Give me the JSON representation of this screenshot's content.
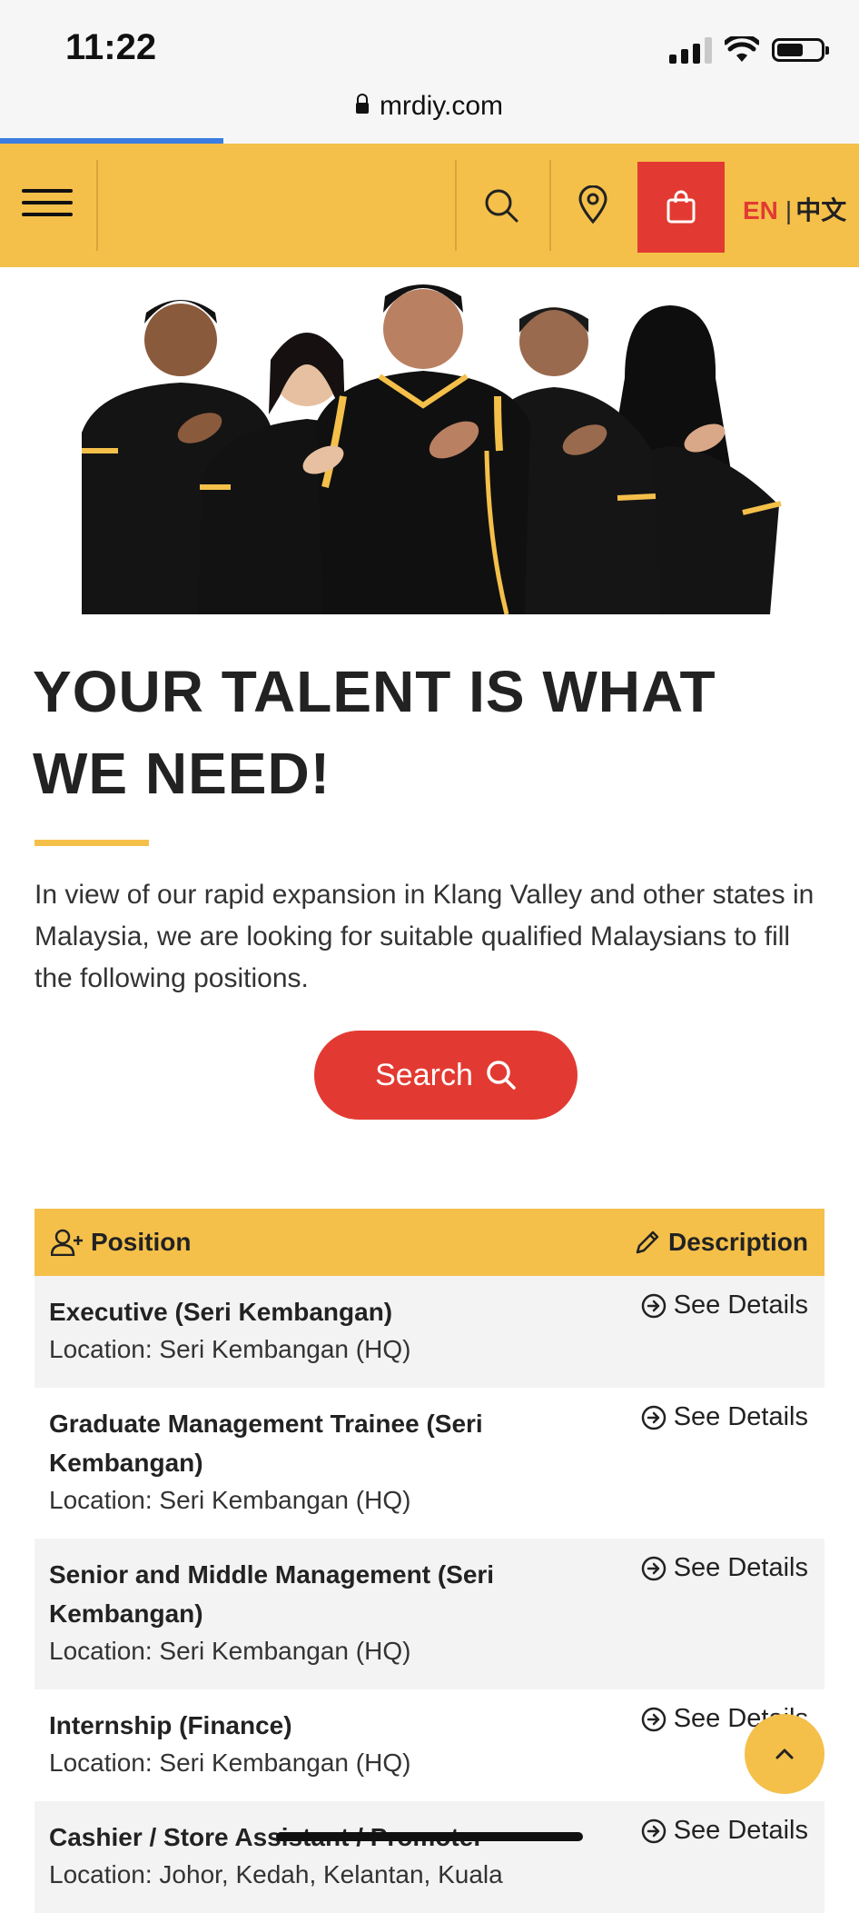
{
  "status": {
    "time": "11:22",
    "url": "mrdiy.com",
    "page_load_progress_fraction": 0.26
  },
  "nav": {
    "lang_en": "EN",
    "lang_separator": "|",
    "lang_zh": "中文"
  },
  "hero": {
    "heading": "YOUR TALENT IS WHAT WE NEED!",
    "intro": "In view of our rapid expansion in Klang Valley and other states in Malaysia, we are looking for suitable qualified Malaysians to fill the following positions.",
    "search_label": "Search"
  },
  "table": {
    "col_position": "Position",
    "col_description": "Description",
    "rows": [
      {
        "title": "Executive (Seri Kembangan)",
        "location": "Location: Seri Kembangan (HQ)",
        "link": "See Details"
      },
      {
        "title": "Graduate Management Trainee (Seri Kembangan)",
        "location": "Location: Seri Kembangan (HQ)",
        "link": "See Details"
      },
      {
        "title": "Senior and Middle Management (Seri Kembangan)",
        "location": "Location: Seri Kembangan (HQ)",
        "link": "See Details"
      },
      {
        "title": "Internship (Finance)",
        "location": "Location: Seri Kembangan (HQ)",
        "link": "See Details"
      },
      {
        "title": "Cashier / Store Assistant / Promoter",
        "location": "Location: Johor, Kedah, Kelantan, Kuala",
        "link": "See Details"
      }
    ]
  },
  "colors": {
    "brand_yellow": "#f4c04a",
    "brand_red": "#e23a32",
    "progress_blue": "#3b7de0"
  },
  "icons": [
    "lock-icon",
    "menu-icon",
    "search-icon",
    "location-pin-icon",
    "shopping-bag-icon",
    "add-user-icon",
    "pencil-icon",
    "arrow-circle-right-icon",
    "chevron-up-icon"
  ]
}
